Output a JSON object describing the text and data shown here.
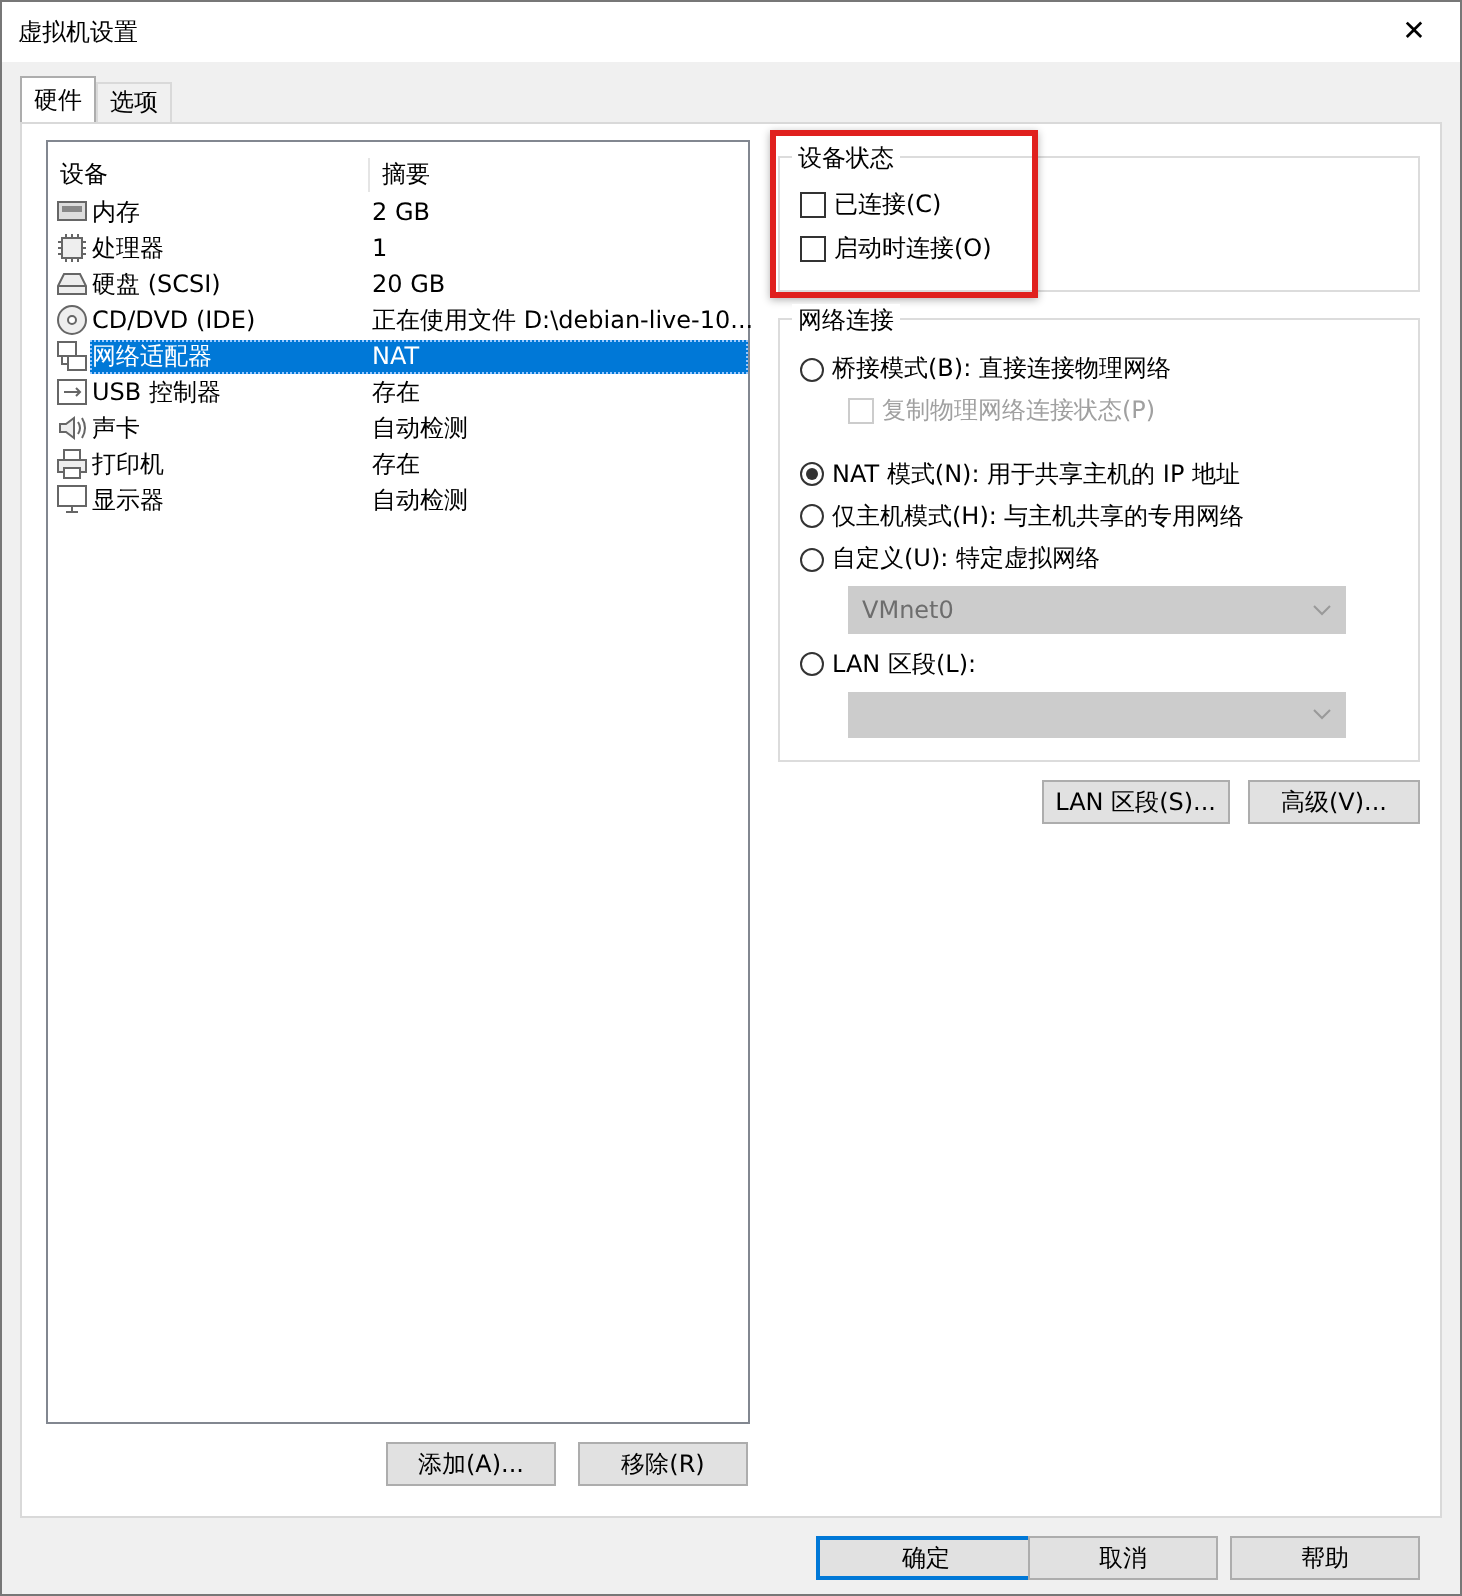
{
  "window": {
    "title": "虚拟机设置",
    "close": "✕"
  },
  "tabs": [
    {
      "label": "硬件",
      "selected": true
    },
    {
      "label": "选项",
      "selected": false
    }
  ],
  "devices": {
    "columns": [
      "设备",
      "摘要"
    ],
    "rows": [
      {
        "kind": "memory",
        "name": "内存",
        "summary": "2 GB",
        "selected": false
      },
      {
        "kind": "cpu",
        "name": "处理器",
        "summary": "1",
        "selected": false
      },
      {
        "kind": "disk",
        "name": "硬盘 (SCSI)",
        "summary": "20 GB",
        "selected": false
      },
      {
        "kind": "cd",
        "name": "CD/DVD (IDE)",
        "summary": "正在使用文件 D:\\debian-live-10...",
        "selected": false
      },
      {
        "kind": "network",
        "name": "网络适配器",
        "summary": "NAT",
        "selected": true
      },
      {
        "kind": "usb",
        "name": "USB 控制器",
        "summary": "存在",
        "selected": false
      },
      {
        "kind": "sound",
        "name": "声卡",
        "summary": "自动检测",
        "selected": false
      },
      {
        "kind": "printer",
        "name": "打印机",
        "summary": "存在",
        "selected": false
      },
      {
        "kind": "display",
        "name": "显示器",
        "summary": "自动检测",
        "selected": false
      }
    ],
    "buttons": [
      "添加(A)...",
      "移除(R)"
    ]
  },
  "device_status": {
    "title": "设备状态",
    "options": [
      {
        "label": "已连接(C)",
        "checked": false
      },
      {
        "label": "启动时连接(O)",
        "checked": false
      }
    ]
  },
  "network": {
    "title": "网络连接",
    "options": [
      {
        "kind": "radio",
        "label": "桥接模式(B): 直接连接物理网络",
        "selected": false
      },
      {
        "kind": "checkbox",
        "label": "复制物理网络连接状态(P)",
        "checked": false,
        "disabled": true
      },
      {
        "kind": "radio",
        "label": "NAT 模式(N): 用于共享主机的 IP 地址",
        "selected": true
      },
      {
        "kind": "radio",
        "label": "仅主机模式(H): 与主机共享的专用网络",
        "selected": false
      },
      {
        "kind": "radio",
        "label": "自定义(U): 特定虚拟网络",
        "selected": false
      },
      {
        "kind": "dropdown",
        "value": "VMnet0",
        "disabled": true
      },
      {
        "kind": "radio",
        "label": "LAN 区段(L):",
        "selected": false
      },
      {
        "kind": "dropdown",
        "disabled": true
      }
    ],
    "buttons": [
      "LAN 区段(S)...",
      "高级(V)..."
    ]
  },
  "footer": [
    {
      "label": "确定",
      "default": true
    },
    {
      "label": "取消",
      "default": false
    },
    {
      "label": "帮助",
      "default": false
    }
  ]
}
